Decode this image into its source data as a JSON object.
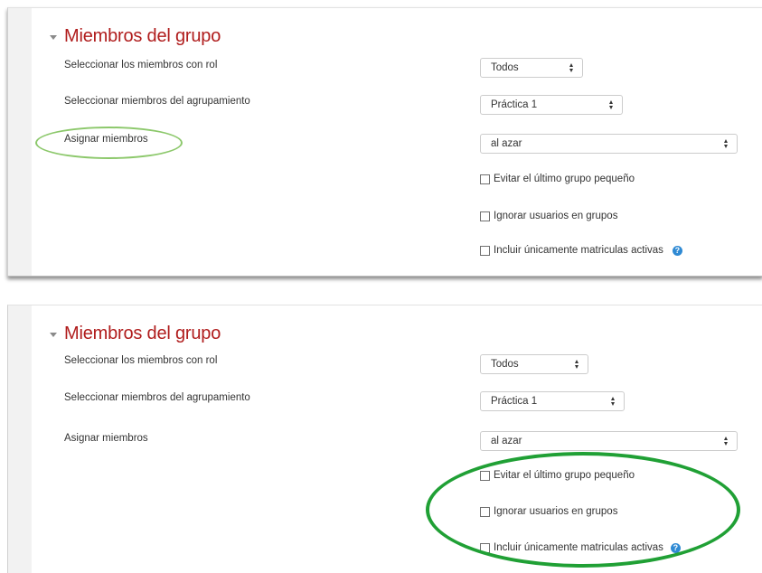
{
  "highlight_color": "#2aa63a",
  "title_color": "#b01c1c",
  "panels": [
    {
      "legend": "Miembros del grupo",
      "role_label": "Seleccionar los miembros con rol",
      "role_value": "Todos",
      "grouping_label": "Seleccionar miembros del agrupamiento",
      "grouping_value": "Práctica 1",
      "assign_label": "Asignar miembros",
      "assign_value": "al azar",
      "check_avoid": "Evitar el último grupo pequeño",
      "check_ignore": "Ignorar usuarios en grupos",
      "check_active": "Incluir únicamente matriculas activas",
      "help_icon": "?"
    },
    {
      "legend": "Miembros del grupo",
      "role_label": "Seleccionar los miembros con rol",
      "role_value": "Todos",
      "grouping_label": "Seleccionar miembros del agrupamiento",
      "grouping_value": "Práctica 1",
      "assign_label": "Asignar miembros",
      "assign_value": "al azar",
      "check_avoid": "Evitar el último grupo pequeño",
      "check_ignore": "Ignorar usuarios en grupos",
      "check_active": "Incluir únicamente matriculas activas",
      "help_icon": "?"
    }
  ]
}
